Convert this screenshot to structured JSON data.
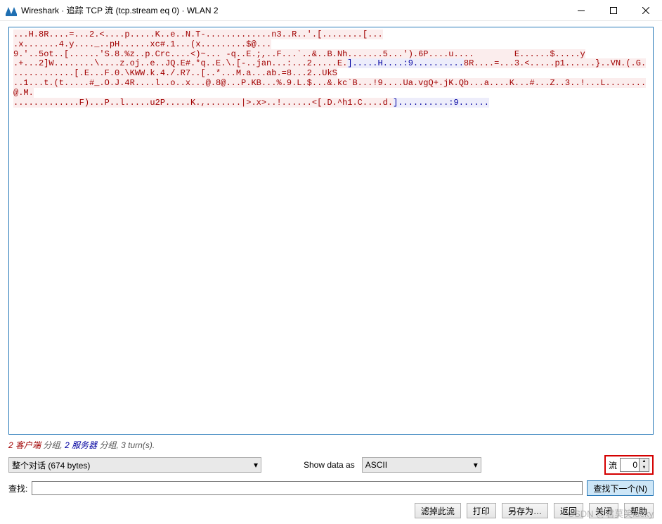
{
  "window": {
    "title": "Wireshark · 追踪 TCP 流 (tcp.stream eq 0) · WLAN 2"
  },
  "stream": {
    "segments": [
      {
        "who": "client",
        "text": "...H.8R....=...2.<....p.....K..e..N.T-.............n3..R..'.[........[...\n.x.......4.y...._..pH......xc#.1...(x.........$@...\n9.'..5ot..[......'S.8.%z..p.Crc....<)~... -q..E.;,..F...`..&..B.Nh.......5...').6P....u....        E......$.....y\n.+...2]W........\\....z.oj..e..JQ.E#.*q..E.\\.[-..jan...:...2.....E."
      },
      {
        "who": "server",
        "text": "].....H....:9.........."
      },
      {
        "who": "client",
        "text": "8R....=...3.<.....p1......}..VN.(.G.\n............[.E...F.0.\\KWW.k.4./.R7..[..*...M.a...ab.=8...2..UkS\n..1...t.(t.....#_.O.J.4R....l..o..x...@.8@...P.KB...%.9.L.$...&.kc`B...!9....Ua.vgQ+.jK.Qb...a....K...#...Z..3..!...L........@.M.\n.............F)...P..l.....u2P.....K.,.......|>.x>..!......<[.D.^h1.C....d."
      },
      {
        "who": "server",
        "text": "]..........:9......"
      }
    ]
  },
  "stats": {
    "client_pkts": "2",
    "client_label": "客户端",
    "server_pkts": "2",
    "server_label": "服务器",
    "pkts_suffix": "分组",
    "turns": "3 turn(s)."
  },
  "options": {
    "conversation": "整个对话 (674 bytes)",
    "show_data_as_label": "Show data as",
    "format": "ASCII",
    "stream_label": "流",
    "stream_value": "0"
  },
  "find": {
    "label": "查找:",
    "value": "",
    "find_next_btn": "查找下一个(N)"
  },
  "buttons": {
    "filter_out": "滤掉此流",
    "print": "打印",
    "save_as": "另存为…",
    "back": "返回",
    "close": "关闭",
    "help": "帮助"
  },
  "watermark": "CSDN @君莫笑lucky"
}
